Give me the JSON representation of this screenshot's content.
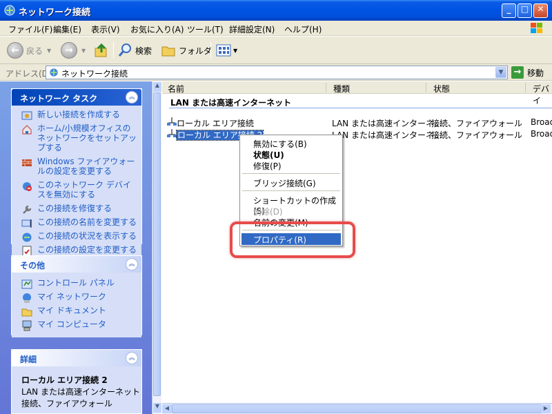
{
  "window": {
    "title": "ネットワーク接続",
    "buttons": {
      "minimize": "_",
      "maximize": "□",
      "close": "✕"
    }
  },
  "menu": [
    "ファイル(F)",
    "編集(E)",
    "表示(V)",
    "お気に入り(A)",
    "ツール(T)",
    "詳細設定(N)",
    "ヘルプ(H)"
  ],
  "toolbar": {
    "back": "戻る",
    "search": "検索",
    "folders": "フォルダ"
  },
  "address": {
    "label": "アドレス(D)",
    "value": "ネットワーク接続",
    "go": "移動"
  },
  "tasks_panel": {
    "title": "ネットワーク タスク",
    "items": [
      "新しい接続を作成する",
      "ホーム/小規模オフィスのネットワークをセットアップする",
      "Windows ファイアウォールの設定を変更する",
      "このネットワーク デバイスを無効にする",
      "この接続を修復する",
      "この接続の名前を変更する",
      "この接続の状況を表示する",
      "この接続の設定を変更する"
    ]
  },
  "other_panel": {
    "title": "その他",
    "items": [
      "コントロール パネル",
      "マイ ネットワーク",
      "マイ ドキュメント",
      "マイ コンピュータ"
    ]
  },
  "details_panel": {
    "title": "詳細",
    "name": "ローカル エリア接続 2",
    "line1": "LAN または高速インターネット",
    "line2": "接続、ファイアウォール"
  },
  "list": {
    "columns": [
      "名前",
      "種類",
      "状態",
      "デバイ"
    ],
    "group": "LAN または高速インターネット",
    "rows": [
      {
        "name": "ローカル エリア接続",
        "type": "LAN または高速インターネ...",
        "status": "接続、ファイアウォール",
        "device": "Broad"
      },
      {
        "name": "ローカル エリア接続 2",
        "type": "LAN または高速インターネ...",
        "status": "接続、ファイアウォール",
        "device": "Broad"
      }
    ]
  },
  "context_menu": {
    "items": [
      "無効にする(B)",
      "状態(U)",
      "修復(P)",
      "ブリッジ接続(G)",
      "ショートカットの作成(S)",
      "削除(D)",
      "名前の変更(M)",
      "プロパティ(R)"
    ]
  },
  "colors": {
    "titlebar": "#0054e3",
    "selection": "#316ac5",
    "task_link": "#215dc6",
    "annotation": "#e84b4b"
  }
}
